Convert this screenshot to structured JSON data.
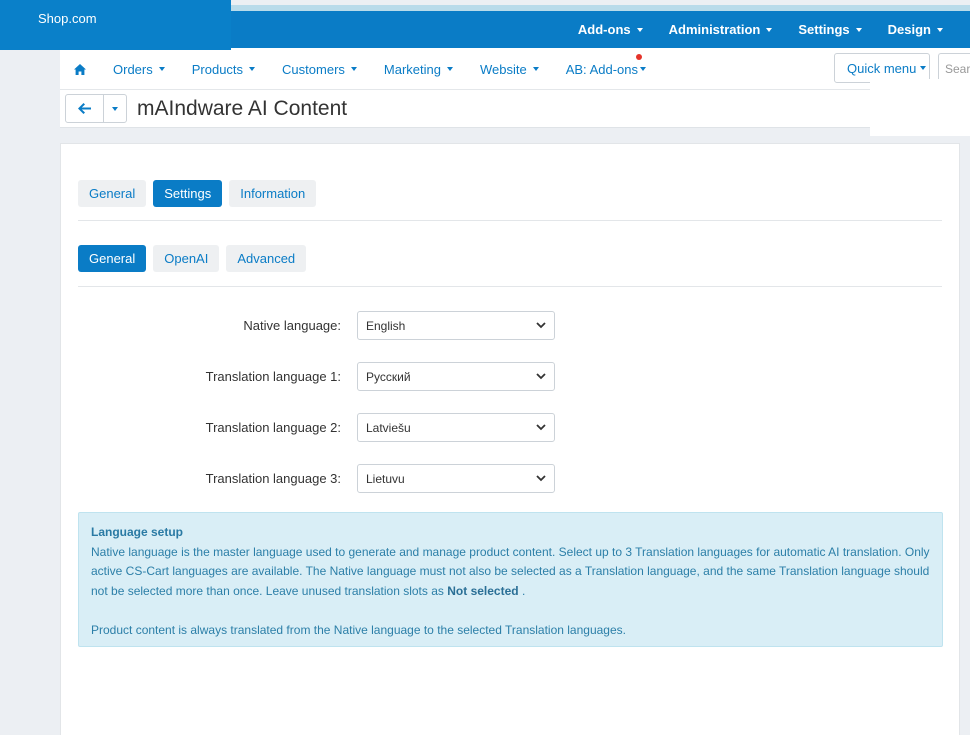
{
  "brand": "Shop.com",
  "topnav": [
    "Add-ons",
    "Administration",
    "Settings",
    "Design"
  ],
  "mainnav": [
    "Orders",
    "Products",
    "Customers",
    "Marketing",
    "Website",
    "AB: Add-ons"
  ],
  "quick_menu": "Quick menu",
  "search_placeholder": "Search",
  "page_title": "mAIndware AI Content",
  "tabs": [
    "General",
    "Settings",
    "Information"
  ],
  "active_tab": "Settings",
  "subtabs": [
    "General",
    "OpenAI",
    "Advanced"
  ],
  "active_subtab": "General",
  "fields": [
    {
      "label": "Native language:",
      "value": "English"
    },
    {
      "label": "Translation language 1:",
      "value": "Русский"
    },
    {
      "label": "Translation language 2:",
      "value": "Latviešu"
    },
    {
      "label": "Translation language 3:",
      "value": "Lietuvu"
    }
  ],
  "info": {
    "title": "Language setup",
    "text_before": "Native language is the master language used to generate and manage product content. Select up to 3 Translation languages for automatic AI translation. Only active CS-Cart languages are available. The Native language must not also be selected as a Translation language, and the same Translation language should not be selected more than once. Leave unused translation slots as",
    "bold": "Not selected",
    "text_after": " .",
    "footer": "Product content is always translated from the Native language to the selected Translation languages."
  },
  "colors": {
    "primary": "#0a7cc6",
    "info_bg": "#d9eef6",
    "notification": "#e5332a"
  }
}
